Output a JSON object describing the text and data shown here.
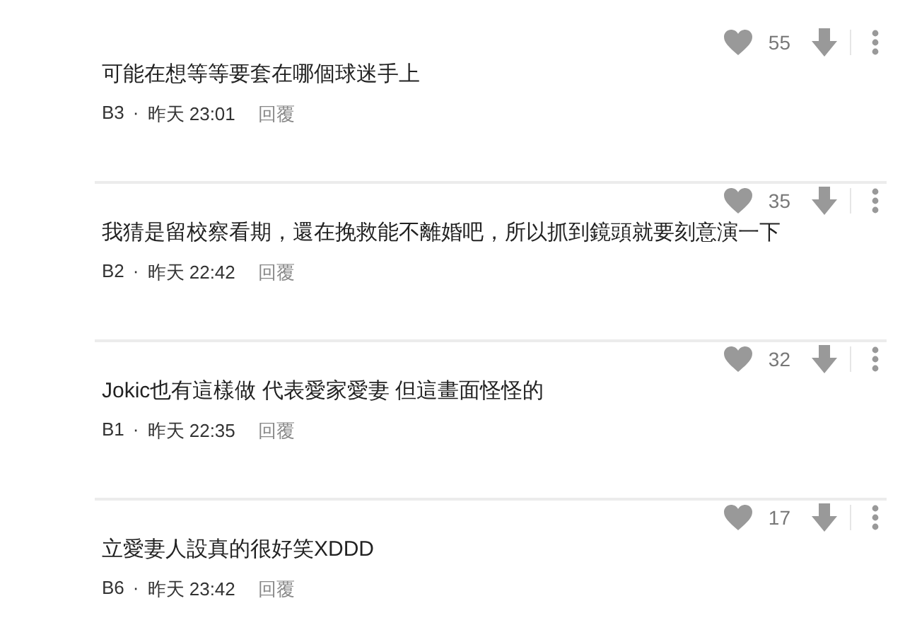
{
  "comments": [
    {
      "likes": "55",
      "text": "可能在想等等要套在哪個球迷手上",
      "author": "B3",
      "dot": "·",
      "time": "昨天 23:01",
      "reply": "回覆"
    },
    {
      "likes": "35",
      "text": "我猜是留校察看期，還在挽救能不離婚吧，所以抓到鏡頭就要刻意演一下",
      "author": "B2",
      "dot": "·",
      "time": "昨天 22:42",
      "reply": "回覆"
    },
    {
      "likes": "32",
      "text": "Jokic也有這樣做 代表愛家愛妻 但這畫面怪怪的",
      "author": "B1",
      "dot": "·",
      "time": "昨天 22:35",
      "reply": "回覆"
    },
    {
      "likes": "17",
      "text": "立愛妻人設真的很好笑XDDD",
      "author": "B6",
      "dot": "·",
      "time": "昨天 23:42",
      "reply": "回覆"
    }
  ]
}
